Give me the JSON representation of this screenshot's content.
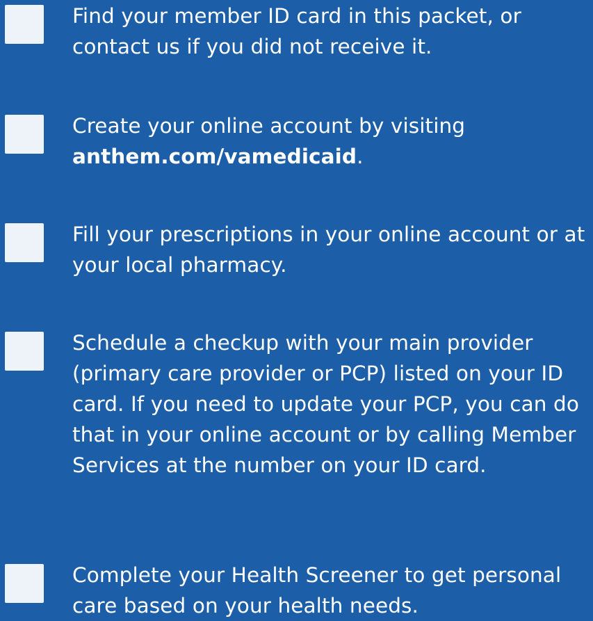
{
  "colors": {
    "background": "#1c5ea8",
    "checkbox": "#eef3fa",
    "text": "#ffffff"
  },
  "checklist": {
    "items": [
      {
        "checked": false,
        "text": "Find your member ID card in this packet, or contact us if you did not receive it."
      },
      {
        "checked": false,
        "text_before": "Create your online account by visiting ",
        "link": "anthem.com/vamedicaid",
        "text_after": "."
      },
      {
        "checked": false,
        "text": "Fill your prescriptions in your online account or at your local pharmacy."
      },
      {
        "checked": false,
        "text": "Schedule a checkup with your main provider (primary care provider or PCP) listed on your ID card. If you need to update your PCP, you can do that in your online account or by calling Member Services at the number on your ID card."
      },
      {
        "checked": false,
        "text": "Complete your Health Screener to get personal care based on your health needs."
      }
    ]
  }
}
